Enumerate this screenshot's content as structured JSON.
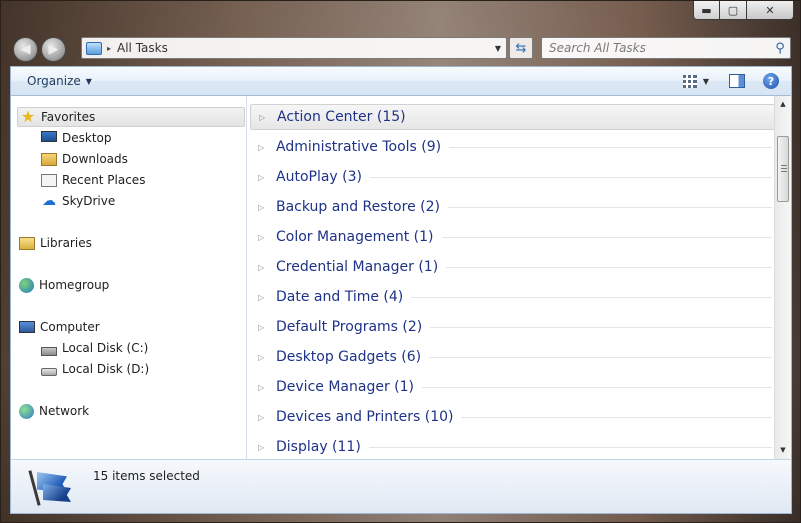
{
  "window": {
    "caption": {
      "minimize": "▬",
      "maximize": "▢",
      "close": "✕"
    }
  },
  "nav": {
    "back_icon": "back-arrow-icon",
    "forward_icon": "forward-arrow-icon"
  },
  "address": {
    "path": "All Tasks",
    "separator": "▸",
    "dropdown": "▼",
    "refresh_icon": "⇆"
  },
  "search": {
    "placeholder": "Search All Tasks",
    "value": "",
    "icon": "⚲"
  },
  "toolbar": {
    "organize_label": "Organize",
    "organize_arrow": "▼",
    "view_arrow": "▼",
    "help_label": "?"
  },
  "sidebar": {
    "favorites": "Favorites",
    "desktop": "Desktop",
    "downloads": "Downloads",
    "recent": "Recent Places",
    "skydrive": "SkyDrive",
    "libraries": "Libraries",
    "homegroup": "Homegroup",
    "computer": "Computer",
    "disk_c": "Local Disk (C:)",
    "disk_d": "Local Disk (D:)",
    "network": "Network",
    "star_glyph": "★",
    "cloud_glyph": "☁"
  },
  "groups": [
    {
      "label": "Action Center (15)"
    },
    {
      "label": "Administrative Tools (9)"
    },
    {
      "label": "AutoPlay (3)"
    },
    {
      "label": "Backup and Restore (2)"
    },
    {
      "label": "Color Management (1)"
    },
    {
      "label": "Credential Manager (1)"
    },
    {
      "label": "Date and Time (4)"
    },
    {
      "label": "Default Programs (2)"
    },
    {
      "label": "Desktop Gadgets (6)"
    },
    {
      "label": "Device Manager (1)"
    },
    {
      "label": "Devices and Printers (10)"
    },
    {
      "label": "Display (11)"
    }
  ],
  "group_arrow": "▷",
  "scrollbar": {
    "up": "▲",
    "down": "▼"
  },
  "details": {
    "status": "15 items selected"
  },
  "colors": {
    "group_text": "#1e3287",
    "accent": "#2f5f9c"
  }
}
